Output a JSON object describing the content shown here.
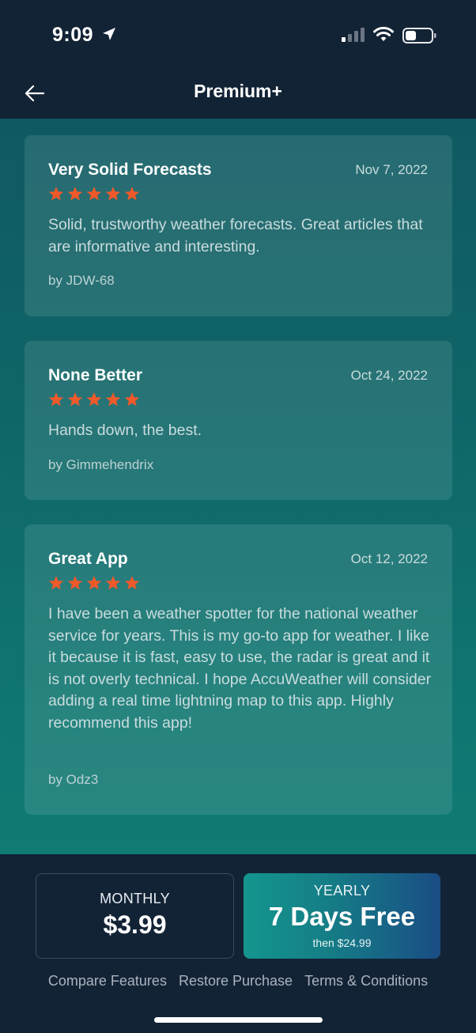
{
  "status_bar": {
    "time": "9:09"
  },
  "header": {
    "title": "Premium+",
    "back_icon": "arrow-left-icon"
  },
  "colors": {
    "star": "#f0592a",
    "accent_gradient_start": "#14968e",
    "accent_gradient_end": "#1a4d85"
  },
  "reviews": [
    {
      "title": "Very Solid Forecasts",
      "date": "Nov 7, 2022",
      "rating": 5,
      "body": "Solid, trustworthy weather forecasts. Great articles that are informative and interesting.",
      "author": "by JDW-68"
    },
    {
      "title": "None Better",
      "date": "Oct 24, 2022",
      "rating": 5,
      "body": "Hands down, the best.",
      "author": "by Gimmehendrix"
    },
    {
      "title": "Great App",
      "date": "Oct 12, 2022",
      "rating": 5,
      "body": "I have been a weather spotter for the national weather service for years. This is my go-to app for weather. I like it because it is fast, easy to use, the radar is great and it is not overly technical. I hope AccuWeather will consider adding a real time lightning map to this app. Highly recommend this app!",
      "author": "by Odz3"
    }
  ],
  "plans": {
    "monthly": {
      "label": "MONTHLY",
      "price": "$3.99"
    },
    "yearly": {
      "label": "YEARLY",
      "offer": "7 Days Free",
      "sub": "then $24.99"
    }
  },
  "footer": {
    "links": [
      "Compare Features",
      "Restore Purchase",
      "Terms & Conditions"
    ]
  }
}
